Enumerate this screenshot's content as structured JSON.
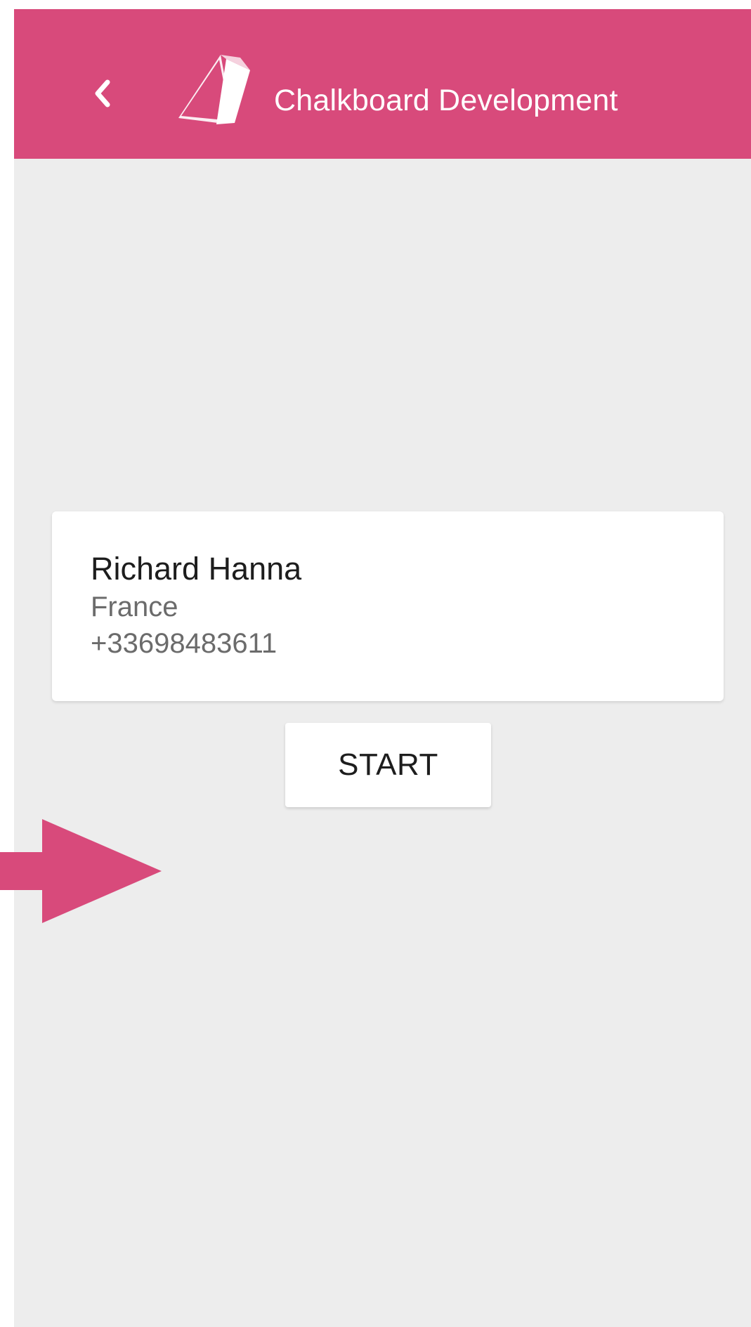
{
  "app_bar": {
    "back_icon": "chevron-left-icon",
    "logo_icon": "chalkboard-logo-icon",
    "title": "Chalkboard Development",
    "color": "#d84a7b"
  },
  "contact": {
    "name": "Richard Hanna",
    "country": "France",
    "phone": "+33698483611"
  },
  "actions": {
    "start_label": "START"
  },
  "annotation": {
    "icon": "arrow-right-icon",
    "color": "#d84a7b"
  },
  "colors": {
    "background": "#ededed",
    "card": "#ffffff",
    "primary_text": "#1d1d1d",
    "secondary_text": "#6b6b6b"
  }
}
